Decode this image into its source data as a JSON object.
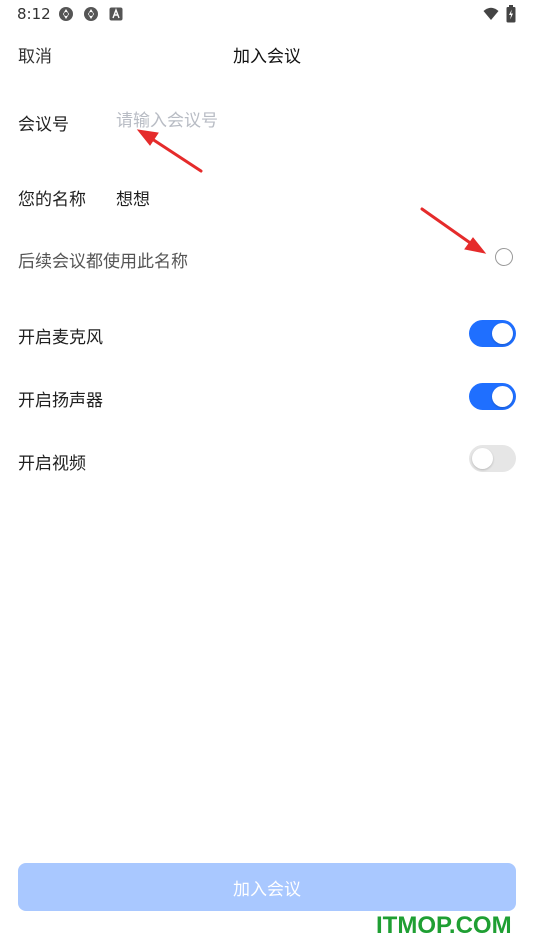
{
  "status_bar": {
    "time": "8:12",
    "icons": [
      "app-notification-icon",
      "app-notification-icon",
      "a-notification-icon",
      "wifi-icon",
      "battery-icon"
    ]
  },
  "header": {
    "cancel_label": "取消",
    "title": "加入会议"
  },
  "meeting_id": {
    "label": "会议号",
    "placeholder": "请输入会议号",
    "value": ""
  },
  "your_name": {
    "label": "您的名称",
    "value": "想想"
  },
  "remember_name": {
    "label": "后续会议都使用此名称",
    "checked": false
  },
  "toggles": [
    {
      "label": "开启麦克风",
      "on": true
    },
    {
      "label": "开启扬声器",
      "on": true
    },
    {
      "label": "开启视频",
      "on": false
    }
  ],
  "join_button": {
    "label": "加入会议",
    "enabled": false
  },
  "colors": {
    "accent": "#1f6fff",
    "toggle_off": "#e6e6e6",
    "button_disabled": "#a9c8ff",
    "placeholder": "#b8bcc4",
    "annotation_arrow": "#e52b2b",
    "watermark": "#1f9f33"
  },
  "watermark": "ITMOP.COM"
}
